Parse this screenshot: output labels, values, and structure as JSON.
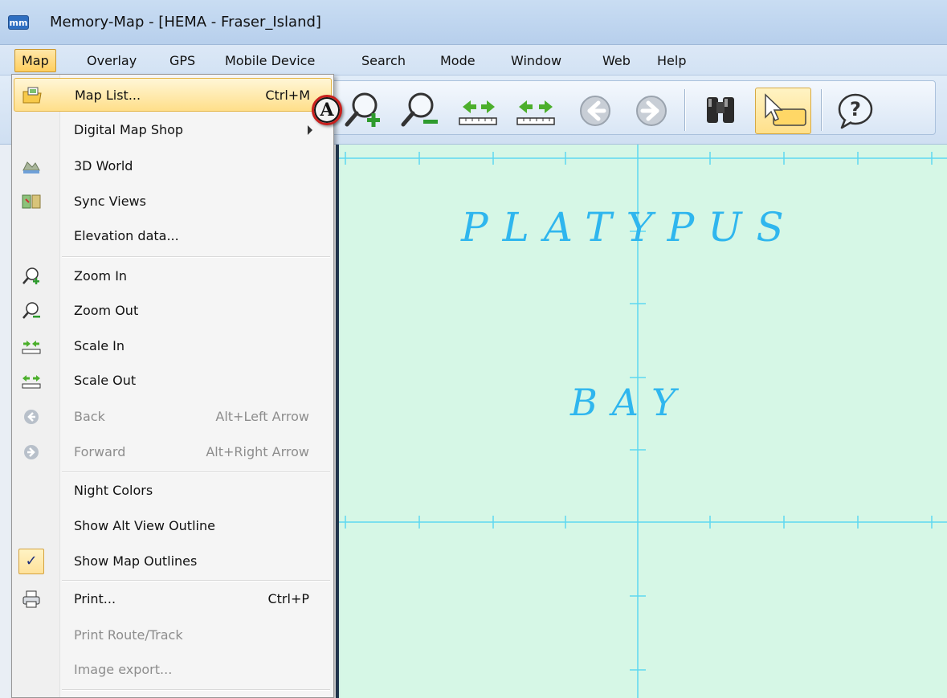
{
  "window": {
    "title": "Memory-Map - [HEMA - Fraser_Island]",
    "logo_text": "mm"
  },
  "menubar": {
    "items": [
      {
        "label": "Map",
        "active": true
      },
      {
        "label": "Overlay"
      },
      {
        "label": "GPS"
      },
      {
        "label": "Mobile Device"
      },
      {
        "label": "Search"
      },
      {
        "label": "Mode"
      },
      {
        "label": "Window"
      },
      {
        "label": "Web"
      },
      {
        "label": "Help"
      }
    ]
  },
  "toolbar": {
    "buttons": [
      {
        "icon": "zoom-in-icon"
      },
      {
        "icon": "zoom-out-icon"
      },
      {
        "icon": "scale-in-icon"
      },
      {
        "icon": "scale-out-icon"
      },
      {
        "icon": "back-icon"
      },
      {
        "icon": "forward-icon"
      },
      {
        "icon": "binoculars-icon"
      },
      {
        "icon": "select-pointer-icon",
        "selected": true
      },
      {
        "icon": "help-icon"
      }
    ]
  },
  "map_menu": {
    "items": [
      {
        "label": "Map List...",
        "shortcut": "Ctrl+M",
        "icon": "map-list-icon",
        "highlighted": true
      },
      {
        "label": "Digital Map Shop",
        "submenu": true
      },
      {
        "label": "3D World",
        "icon": "3d-world-icon"
      },
      {
        "label": "Sync Views",
        "icon": "sync-views-icon"
      },
      {
        "label": "Elevation data..."
      },
      {
        "label": "Zoom In",
        "icon": "zoom-in-icon"
      },
      {
        "label": "Zoom Out",
        "icon": "zoom-out-icon"
      },
      {
        "label": "Scale In",
        "icon": "scale-in-icon"
      },
      {
        "label": "Scale Out",
        "icon": "scale-out-icon"
      },
      {
        "label": "Back",
        "shortcut": "Alt+Left Arrow",
        "icon": "back-icon",
        "disabled": true
      },
      {
        "label": "Forward",
        "shortcut": "Alt+Right Arrow",
        "icon": "forward-icon",
        "disabled": true
      },
      {
        "label": "Night Colors"
      },
      {
        "label": "Show Alt View Outline"
      },
      {
        "label": "Show Map Outlines",
        "checked": true,
        "icon": "checkmark-icon"
      },
      {
        "label": "Print...",
        "shortcut": "Ctrl+P",
        "icon": "print-icon"
      },
      {
        "label": "Print Route/Track",
        "disabled": true
      },
      {
        "label": "Image export...",
        "disabled": true
      }
    ]
  },
  "map": {
    "labels": [
      "PLATYPUS",
      "BAY"
    ],
    "background_color": "#d6f7e6",
    "grid_color": "#5fd8f0",
    "label_color": "#2fb6ee"
  },
  "callout": {
    "letter": "A"
  }
}
